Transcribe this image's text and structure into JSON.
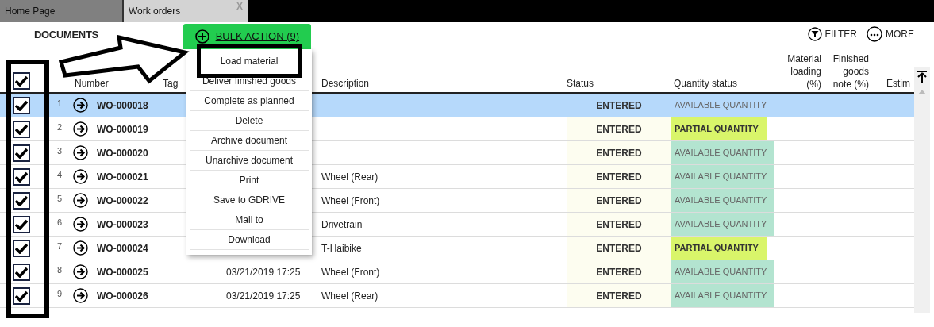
{
  "tabs": [
    {
      "label": "Home Page",
      "selected": false
    },
    {
      "label": "Work orders",
      "selected": true,
      "close": "X"
    }
  ],
  "toolbar": {
    "title": "DOCUMENTS",
    "bulk_button": "BULK ACTION (9)",
    "filter": "FILTER",
    "more": "MORE"
  },
  "bulk_menu": [
    {
      "label": "Load material"
    },
    {
      "label": "Deliver finished goods"
    },
    {
      "label": "Complete as planned"
    },
    {
      "label": "Delete"
    },
    {
      "label": "Archive document"
    },
    {
      "label": "Unarchive document"
    },
    {
      "label": "Print"
    },
    {
      "label": "Save to GDRIVE"
    },
    {
      "label": "Mail to"
    },
    {
      "label": "Download"
    }
  ],
  "table": {
    "select_all_checked": true,
    "columns": [
      "Number",
      "Tag",
      "Description",
      "Status",
      "Quantity status",
      "Material loading (%)",
      "Finished goods note (%)",
      "Estim"
    ],
    "rows": [
      {
        "index": "1",
        "checked": true,
        "selected": true,
        "number": "WO-000018",
        "status": "ENTERED",
        "quantity_status": {
          "kind": "available",
          "text": "AVAILABLE QUANTITY"
        }
      },
      {
        "index": "2",
        "checked": true,
        "selected": false,
        "number": "WO-000019",
        "status": "ENTERED",
        "quantity_status": {
          "kind": "partial",
          "text": "PARTIAL QUANTITY"
        }
      },
      {
        "index": "3",
        "checked": true,
        "selected": false,
        "number": "WO-000020",
        "status": "ENTERED",
        "quantity_status": {
          "kind": "available",
          "text": "AVAILABLE QUANTITY"
        }
      },
      {
        "index": "4",
        "checked": true,
        "selected": false,
        "number": "WO-000021",
        "description": "Wheel (Rear)",
        "status": "ENTERED",
        "quantity_status": {
          "kind": "available",
          "text": "AVAILABLE QUANTITY"
        }
      },
      {
        "index": "5",
        "checked": true,
        "selected": false,
        "number": "WO-000022",
        "description": "Wheel (Front)",
        "status": "ENTERED",
        "quantity_status": {
          "kind": "available",
          "text": "AVAILABLE QUANTITY"
        }
      },
      {
        "index": "6",
        "checked": true,
        "selected": false,
        "number": "WO-000023",
        "description": "Drivetrain",
        "status": "ENTERED",
        "quantity_status": {
          "kind": "available",
          "text": "AVAILABLE QUANTITY"
        }
      },
      {
        "index": "7",
        "checked": true,
        "selected": false,
        "number": "WO-000024",
        "description": "T-Haibike",
        "status": "ENTERED",
        "quantity_status": {
          "kind": "partial",
          "text": "PARTIAL QUANTITY"
        }
      },
      {
        "index": "8",
        "checked": true,
        "selected": false,
        "number": "WO-000025",
        "date": "03/21/2019 17:25",
        "description": "Wheel (Front)",
        "status": "ENTERED",
        "quantity_status": {
          "kind": "available",
          "text": "AVAILABLE QUANTITY"
        }
      },
      {
        "index": "9",
        "checked": true,
        "selected": false,
        "number": "WO-000026",
        "date": "03/21/2019 17:25",
        "description": "Wheel (Rear)",
        "status": "ENTERED",
        "quantity_status": {
          "kind": "available",
          "text": "AVAILABLE QUANTITY"
        }
      }
    ]
  }
}
